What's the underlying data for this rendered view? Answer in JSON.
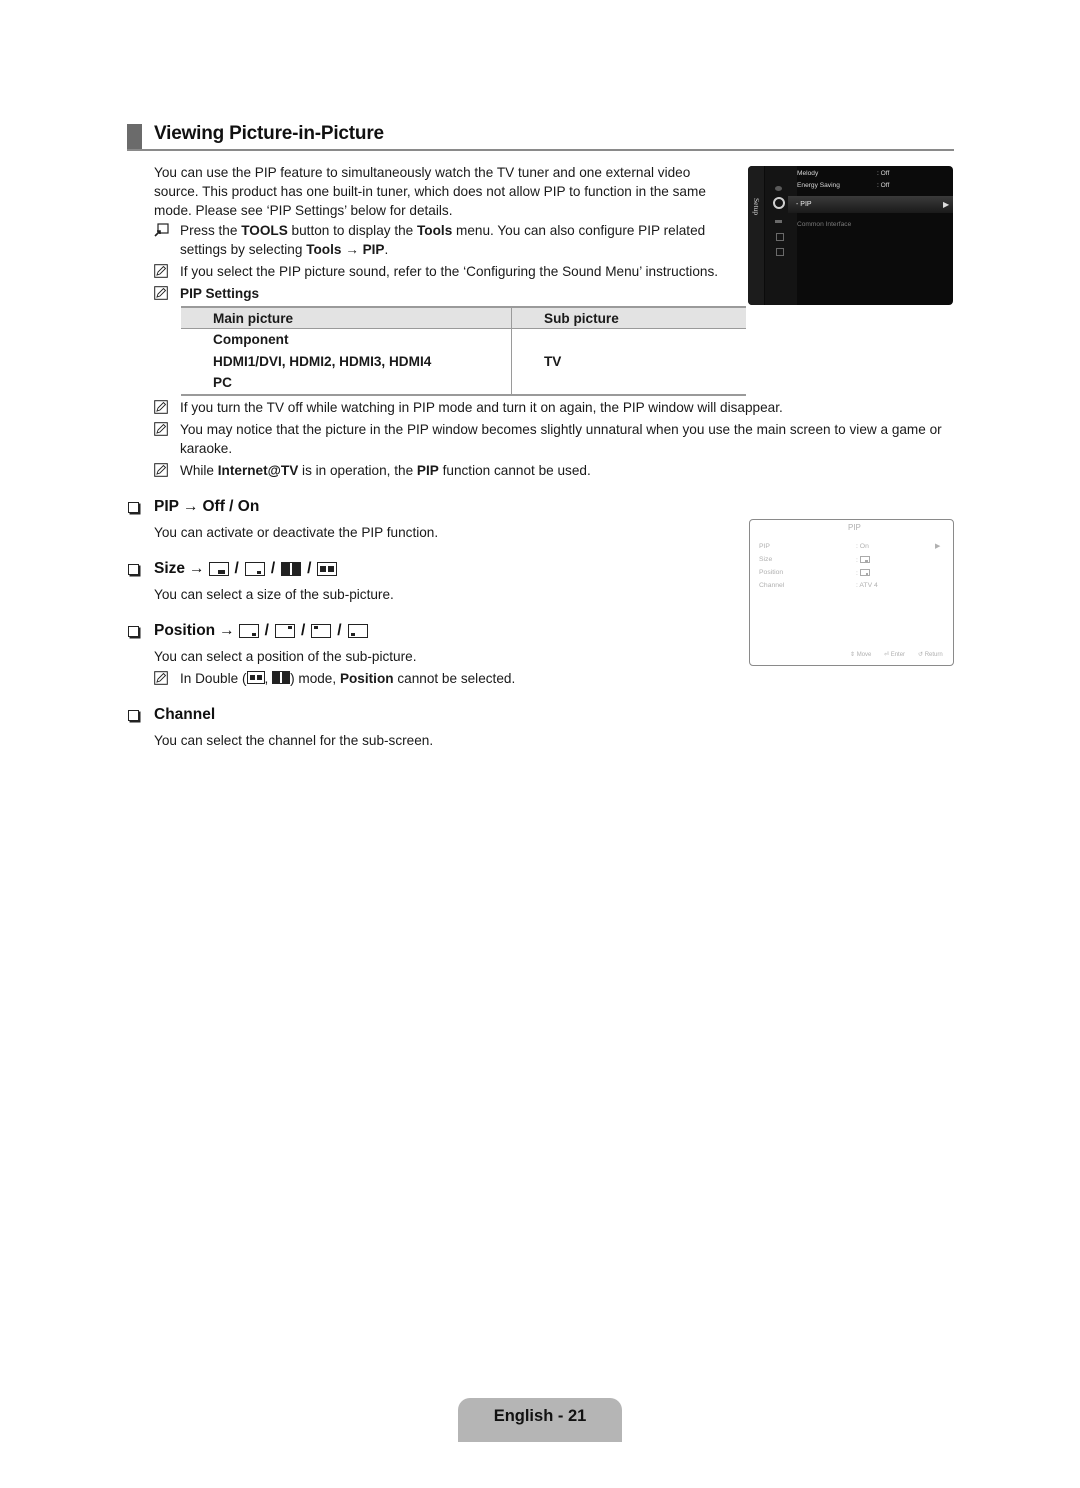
{
  "page": {
    "title": "Viewing Picture-in-Picture",
    "intro": "You can use the PIP feature to simultaneously watch the TV tuner and one external video source. This product has one built-in tuner, which does not allow PIP to function in the same mode. Please see ‘PIP Settings’ below for details.",
    "intro_lines": [
      "You can use the PIP feature to simultaneously watch the TV tuner and one external video",
      "source. This product has one built-in tuner, which does not allow PIP to function in the same",
      "mode. Please see ‘PIP Settings’ below for details."
    ],
    "tools_note": {
      "icon": "tools-icon",
      "parts": [
        "Press the ",
        "TOOLS",
        " button to display the ",
        "Tools",
        " menu. You can also configure PIP related settings by selecting ",
        "Tools → PIP",
        "."
      ]
    },
    "notes_top": [
      {
        "icon": "note-icon",
        "text": "If you select the PIP picture sound, refer to the ‘Configuring the Sound Menu’ instructions."
      },
      {
        "icon": "note-icon",
        "text": "PIP Settings"
      }
    ],
    "pip_settings_table": {
      "headers": [
        "Main picture",
        "Sub picture"
      ],
      "main_picture": [
        "Component",
        "HDMI1/DVI, HDMI2, HDMI3, HDMI4",
        "PC"
      ],
      "sub_picture": "TV"
    },
    "notes_bottom": [
      {
        "icon": "note-icon",
        "text": "If you turn the TV off while watching in PIP mode and turn it on again, the PIP window will disappear."
      },
      {
        "icon": "note-icon",
        "text": "You may notice that the picture in the PIP window becomes slightly unnatural when you use the main screen to view a game or karaoke."
      },
      {
        "icon": "note-icon",
        "parts": [
          "While ",
          "Internet@TV",
          " is in operation, the ",
          "PIP",
          " function cannot be used."
        ]
      }
    ],
    "sections": [
      {
        "heading": "PIP",
        "arrow": "→",
        "options": "Off / On",
        "description": "You can activate or deactivate the PIP function."
      },
      {
        "heading": "Size",
        "arrow": "→",
        "options_icons": [
          "size-large-icon",
          "size-small-icon",
          "size-double-split-icon",
          "size-double-pip-icon"
        ],
        "description": "You can select a size of the sub-picture."
      },
      {
        "heading": "Position",
        "arrow": "→",
        "options_icons": [
          "position-bottom-right-icon",
          "position-top-right-icon",
          "position-top-left-icon",
          "position-bottom-left-icon"
        ],
        "description": "You can select a position of the sub-picture.",
        "note": {
          "icon": "note-icon",
          "parts": [
            "In Double (",
            ", ",
            ") mode, ",
            "Position",
            " cannot be selected."
          ]
        }
      },
      {
        "heading": "Channel",
        "description": "You can select the channel for the sub-screen."
      }
    ],
    "footer": "English - 21"
  },
  "osd_setup": {
    "side_label": "Setup",
    "items": [
      {
        "label": "Melody",
        "value": ": Off"
      },
      {
        "label": "Energy Saving",
        "value": ": Off"
      },
      {
        "label": "- PIP",
        "value": "",
        "selected": true
      },
      {
        "label": "Common Interface",
        "value": "",
        "dim": true
      }
    ]
  },
  "osd_pip": {
    "title": "PIP",
    "rows": [
      {
        "label": "PIP",
        "value": ": On"
      },
      {
        "label": "Size",
        "value": ":"
      },
      {
        "label": "Position",
        "value": ":"
      },
      {
        "label": "Channel",
        "value": ": ATV 4"
      }
    ],
    "hints": [
      "Move",
      "Enter",
      "Return"
    ]
  }
}
